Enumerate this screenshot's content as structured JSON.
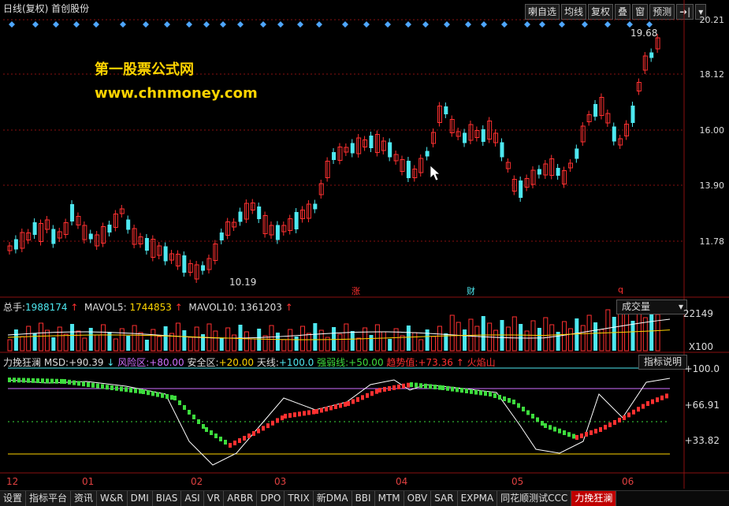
{
  "header": {
    "title": "日线(复权) 首创股份",
    "buttons": [
      "喇自选",
      "均线",
      "复权",
      "叠",
      "窗",
      "预测",
      "➜|",
      "▾"
    ]
  },
  "price_axis": [
    "20.21",
    "18.12",
    "16.00",
    "13.90",
    "11.78"
  ],
  "annotations": {
    "high": "19.68",
    "low": "10.19",
    "marker_zhang": "涨",
    "marker_cai": "财",
    "marker_q": "q"
  },
  "watermark": {
    "line1": "第一股票公式网",
    "line2": "www.chnmoney.com"
  },
  "volume_panel": {
    "total_label": "总手:",
    "total_value": "1988174",
    "mavol5_label": "MAVOL5:",
    "mavol5_value": "1744853",
    "mavol10_label": "MAVOL10:",
    "mavol10_value": "1361203",
    "selector": "成交量",
    "axis_top": "22149",
    "axis_unit": "X100"
  },
  "indicator_panel": {
    "name": "力挽狂澜",
    "msd_label": "MSD:",
    "msd_value": "+90.39",
    "risk_label": "风险区:",
    "risk_value": "+80.00",
    "safe_label": "安全区:",
    "safe_value": "+20.00",
    "sky_label": "天线:",
    "sky_value": "+100.0",
    "strength_label": "强弱线:",
    "strength_value": "+50.00",
    "trend_label": "趋势值:",
    "trend_value": "+73.36",
    "volcano": "火焰山",
    "explain_button": "指标说明",
    "axis": [
      "+100.0",
      "+66.91",
      "+33.82"
    ]
  },
  "x_axis": [
    "12",
    "01",
    "02",
    "03",
    "04",
    "05",
    "06"
  ],
  "tabs": [
    "设置",
    "指标平台",
    "资讯",
    "W&R",
    "DMI",
    "BIAS",
    "ASI",
    "VR",
    "ARBR",
    "DPO",
    "TRIX",
    "新DMA",
    "BBI",
    "MTM",
    "OBV",
    "SAR",
    "EXPMA",
    "同花顺测试CCC",
    "力挽狂澜"
  ],
  "colors": {
    "up": "#ff3030",
    "down": "#4ee8f0",
    "grid": "#8a1010",
    "accent_yellow": "#ffd400"
  }
}
